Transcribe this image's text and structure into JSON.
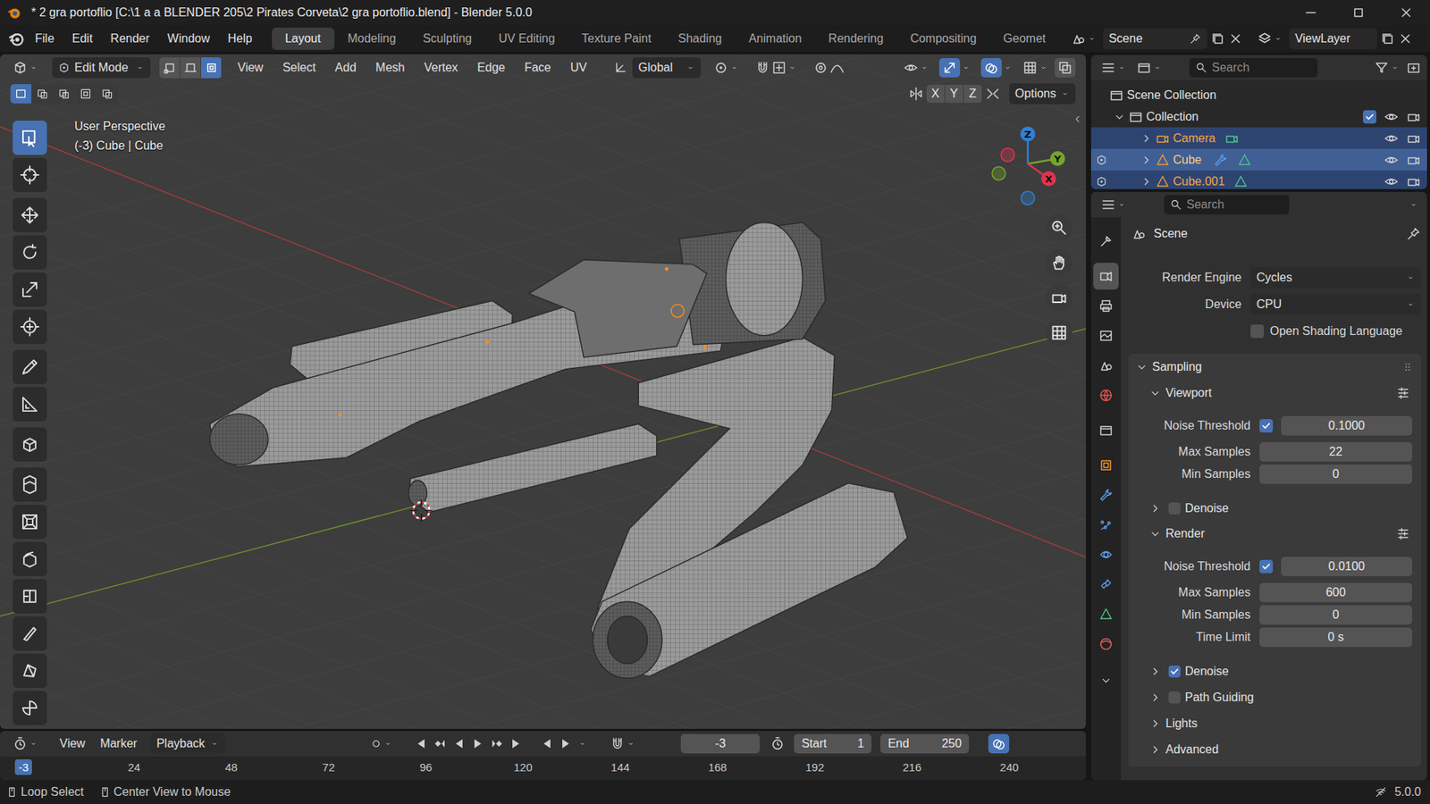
{
  "window": {
    "title": "* 2 gra portoflio [C:\\1 a a BLENDER 205\\2 Pirates Corveta\\2 gra portoflio.blend] - Blender 5.0.0"
  },
  "menu": [
    "File",
    "Edit",
    "Render",
    "Window",
    "Help"
  ],
  "workspaces": [
    {
      "label": "Layout",
      "selected": true
    },
    {
      "label": "Modeling",
      "selected": false
    },
    {
      "label": "Sculpting",
      "selected": false
    },
    {
      "label": "UV Editing",
      "selected": false
    },
    {
      "label": "Texture Paint",
      "selected": false
    },
    {
      "label": "Shading",
      "selected": false
    },
    {
      "label": "Animation",
      "selected": false
    },
    {
      "label": "Rendering",
      "selected": false
    },
    {
      "label": "Compositing",
      "selected": false
    },
    {
      "label": "Geomet",
      "selected": false
    }
  ],
  "scene": "Scene",
  "view_layer": "ViewLayer",
  "viewport": {
    "mode": "Edit Mode",
    "select_modes": [
      {
        "selected": false
      },
      {
        "selected": false
      },
      {
        "selected": true
      }
    ],
    "menus": [
      "View",
      "Select",
      "Add",
      "Mesh",
      "Vertex",
      "Edge",
      "Face",
      "UV"
    ],
    "orientation": "Global",
    "box_select_modes": [
      {
        "selected": true
      },
      {
        "selected": false
      },
      {
        "selected": false
      },
      {
        "selected": false
      },
      {
        "selected": false
      }
    ],
    "mirror_axes": [
      {
        "label": "X",
        "on": false
      },
      {
        "label": "Y",
        "on": false
      },
      {
        "label": "Z",
        "on": false
      }
    ],
    "options": "Options",
    "info": [
      "User Perspective",
      "(-3) Cube | Cube"
    ],
    "gizmo_axes": [
      {
        "label": "Z",
        "color": "#2f80d8"
      },
      {
        "label": "Y",
        "color": "#76a52a"
      },
      {
        "label": "X",
        "color": "#e0344d"
      }
    ],
    "tools": [
      {
        "selected": true
      },
      {
        "selected": false
      },
      {
        "selected": false
      },
      {
        "selected": false
      },
      {
        "selected": false
      },
      {
        "selected": false
      },
      {
        "selected": false
      },
      {
        "selected": false
      },
      {
        "selected": false
      },
      {
        "selected": false
      },
      {
        "selected": false
      },
      {
        "selected": false
      },
      {
        "selected": false
      },
      {
        "selected": false
      },
      {
        "selected": false
      },
      {
        "selected": false
      }
    ]
  },
  "outliner": {
    "search_placeholder": "Search",
    "scene_collection": "Scene Collection",
    "collection": {
      "label": "Collection",
      "checked": true
    },
    "objects": [
      {
        "name": "Camera",
        "kind": "camera",
        "selected": true,
        "active": false,
        "edit_mode": false,
        "modifiers": false
      },
      {
        "name": "Cube",
        "kind": "mesh",
        "selected": true,
        "active": true,
        "edit_mode": true,
        "modifiers": true
      },
      {
        "name": "Cube.001",
        "kind": "mesh",
        "selected": true,
        "active": false,
        "edit_mode": true,
        "modifiers": false
      }
    ]
  },
  "properties": {
    "search_placeholder": "Search",
    "tabs": [
      {
        "selected": false
      },
      {
        "selected": true
      },
      {
        "selected": false
      },
      {
        "selected": false
      },
      {
        "selected": false
      },
      {
        "selected": false
      },
      {
        "selected": false
      },
      {
        "selected": false
      },
      {
        "selected": false
      },
      {
        "selected": false
      },
      {
        "selected": false
      },
      {
        "selected": false
      },
      {
        "selected": false
      },
      {
        "selected": false
      }
    ],
    "context": "Scene",
    "fields": [
      {
        "label": "Render Engine",
        "value": "Cycles"
      },
      {
        "label": "Device",
        "value": "CPU"
      }
    ],
    "osl": {
      "label": "Open Shading Language",
      "checked": false
    },
    "sampling": {
      "label": "Sampling",
      "expanded": true,
      "sections": [
        {
          "label": "Viewport",
          "expanded": true,
          "rows": [
            {
              "kind": "toggle",
              "label": "Noise Threshold",
              "checked": true,
              "value": "0.1000"
            },
            {
              "kind": "number",
              "label": "Max Samples",
              "value": "22"
            },
            {
              "kind": "number",
              "label": "Min Samples",
              "value": "0"
            }
          ],
          "subpanels": [
            {
              "label": "Denoise",
              "checked": false,
              "expanded": false
            }
          ]
        },
        {
          "label": "Render",
          "expanded": true,
          "rows": [
            {
              "kind": "toggle",
              "label": "Noise Threshold",
              "checked": true,
              "value": "0.0100"
            },
            {
              "kind": "number",
              "label": "Max Samples",
              "value": "600"
            },
            {
              "kind": "number",
              "label": "Min Samples",
              "value": "0"
            },
            {
              "kind": "number",
              "label": "Time Limit",
              "value": "0 s"
            }
          ],
          "subpanels": [
            {
              "label": "Denoise",
              "checked": true,
              "expanded": false
            },
            {
              "label": "Path Guiding",
              "checked": false,
              "expanded": false
            }
          ]
        }
      ],
      "subpanels": [
        {
          "label": "Lights",
          "expanded": false
        },
        {
          "label": "Advanced",
          "expanded": false
        }
      ]
    }
  },
  "timeline": {
    "menus": [
      "View",
      "Marker"
    ],
    "playback": "Playback",
    "current_frame": "-3",
    "start": {
      "label": "Start",
      "value": "1"
    },
    "end": {
      "label": "End",
      "value": "250"
    },
    "ruler_current": "-3",
    "ruler": [
      "24",
      "48",
      "72",
      "96",
      "120",
      "144",
      "168",
      "192",
      "216",
      "240"
    ]
  },
  "status_bar": {
    "hints": [
      "Loop Select",
      "Center View to Mouse"
    ],
    "version": "5.0.0"
  }
}
